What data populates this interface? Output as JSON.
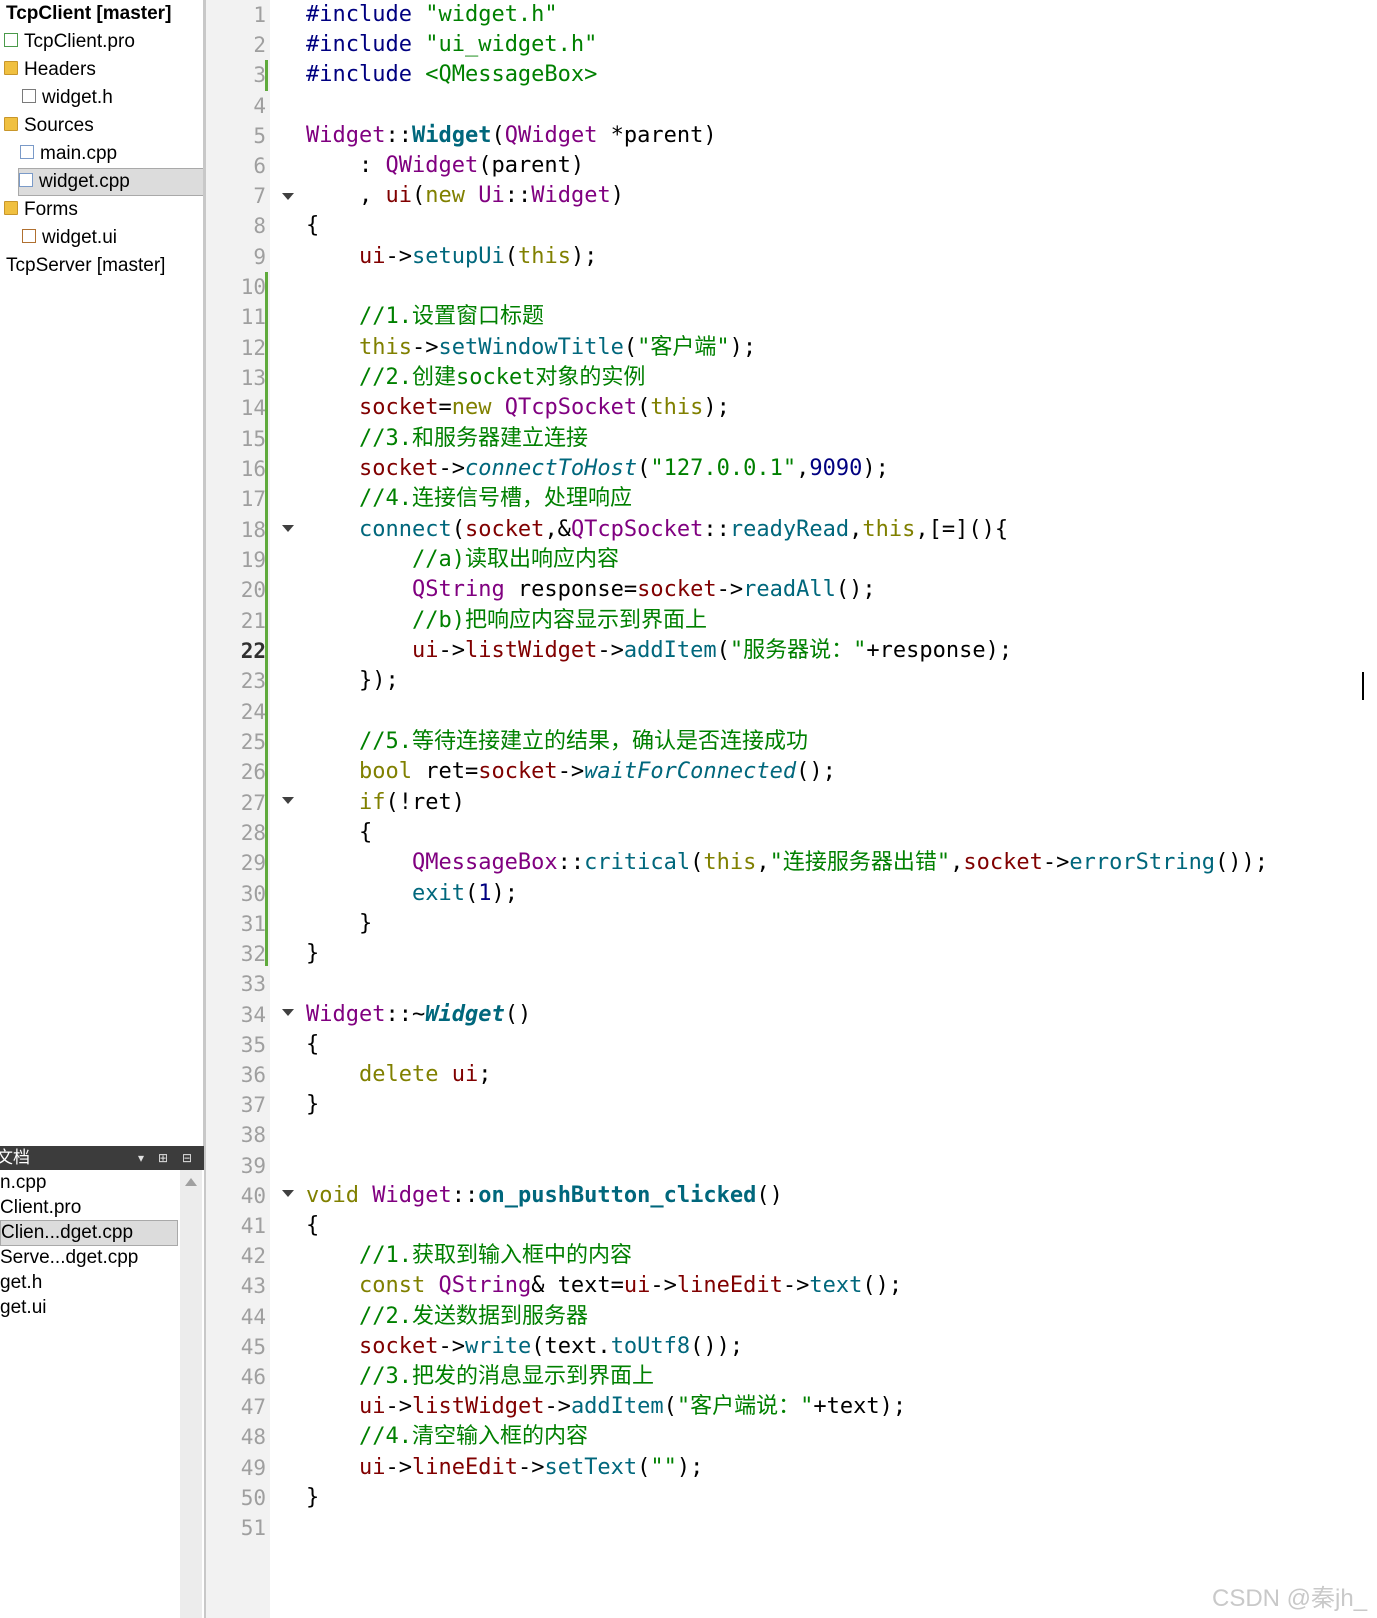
{
  "project_tree": {
    "items": [
      {
        "label": "TcpClient [master]",
        "icon": "none",
        "bold": true
      },
      {
        "label": "TcpClient.pro",
        "icon": "pro-file-icon"
      },
      {
        "label": "Headers",
        "icon": "folder-icon"
      },
      {
        "label": "widget.h",
        "icon": "header-file-icon"
      },
      {
        "label": "Sources",
        "icon": "folder-icon"
      },
      {
        "label": "main.cpp",
        "icon": "cpp-file-icon"
      },
      {
        "label": "widget.cpp",
        "icon": "cpp-file-icon",
        "selected": true
      },
      {
        "label": "Forms",
        "icon": "folder-icon"
      },
      {
        "label": "widget.ui",
        "icon": "ui-file-icon"
      },
      {
        "label": "TcpServer [master]",
        "icon": "none"
      }
    ]
  },
  "open_documents": {
    "title": "文档",
    "items": [
      {
        "label": "n.cpp"
      },
      {
        "label": "Client.pro"
      },
      {
        "label": "Clien...dget.cpp",
        "selected": true
      },
      {
        "label": "Serve...dget.cpp"
      },
      {
        "label": "get.h"
      },
      {
        "label": "get.ui"
      }
    ]
  },
  "editor": {
    "current_line": "22",
    "lines": [
      {
        "n": "1",
        "t": [
          [
            "pp",
            "#include "
          ],
          [
            "str",
            "\"widget.h\""
          ]
        ]
      },
      {
        "n": "2",
        "t": [
          [
            "pp",
            "#include "
          ],
          [
            "str",
            "\"ui_widget.h\""
          ]
        ]
      },
      {
        "n": "3",
        "t": [
          [
            "pp",
            "#include "
          ],
          [
            "str",
            "<QMessageBox>"
          ]
        ]
      },
      {
        "n": "4",
        "t": []
      },
      {
        "n": "5",
        "t": [
          [
            "cls",
            "Widget"
          ],
          [
            "plain",
            "::"
          ],
          [
            "fnb",
            "Widget"
          ],
          [
            "plain",
            "("
          ],
          [
            "cls",
            "QWidget"
          ],
          [
            "plain",
            " *parent)"
          ]
        ]
      },
      {
        "n": "6",
        "t": [
          [
            "plain",
            "    : "
          ],
          [
            "cls",
            "QWidget"
          ],
          [
            "plain",
            "(parent)"
          ]
        ]
      },
      {
        "n": "7",
        "t": [
          [
            "plain",
            "    , "
          ],
          [
            "mem",
            "ui"
          ],
          [
            "plain",
            "("
          ],
          [
            "kw",
            "new"
          ],
          [
            "plain",
            " "
          ],
          [
            "cls",
            "Ui"
          ],
          [
            "plain",
            "::"
          ],
          [
            "cls",
            "Widget"
          ],
          [
            "plain",
            ")"
          ]
        ]
      },
      {
        "n": "8",
        "t": [
          [
            "plain",
            "{"
          ]
        ]
      },
      {
        "n": "9",
        "t": [
          [
            "plain",
            "    "
          ],
          [
            "mem",
            "ui"
          ],
          [
            "plain",
            "->"
          ],
          [
            "fn",
            "setupUi"
          ],
          [
            "plain",
            "("
          ],
          [
            "kw",
            "this"
          ],
          [
            "plain",
            ");"
          ]
        ]
      },
      {
        "n": "10",
        "t": []
      },
      {
        "n": "11",
        "t": [
          [
            "cm",
            "    //1.设置窗口标题"
          ]
        ]
      },
      {
        "n": "12",
        "t": [
          [
            "plain",
            "    "
          ],
          [
            "kw",
            "this"
          ],
          [
            "plain",
            "->"
          ],
          [
            "fn",
            "setWindowTitle"
          ],
          [
            "plain",
            "("
          ],
          [
            "str",
            "\"客户端\""
          ],
          [
            "plain",
            ");"
          ]
        ]
      },
      {
        "n": "13",
        "t": [
          [
            "cm",
            "    //2.创建socket对象的实例"
          ]
        ]
      },
      {
        "n": "14",
        "t": [
          [
            "plain",
            "    "
          ],
          [
            "mem",
            "socket"
          ],
          [
            "plain",
            "="
          ],
          [
            "kw",
            "new"
          ],
          [
            "plain",
            " "
          ],
          [
            "cls",
            "QTcpSocket"
          ],
          [
            "plain",
            "("
          ],
          [
            "kw",
            "this"
          ],
          [
            "plain",
            ");"
          ]
        ]
      },
      {
        "n": "15",
        "t": [
          [
            "cm",
            "    //3.和服务器建立连接"
          ]
        ]
      },
      {
        "n": "16",
        "t": [
          [
            "plain",
            "    "
          ],
          [
            "mem",
            "socket"
          ],
          [
            "plain",
            "->"
          ],
          [
            "fni",
            "connectToHost"
          ],
          [
            "plain",
            "("
          ],
          [
            "str",
            "\"127.0.0.1\""
          ],
          [
            "plain",
            ","
          ],
          [
            "num",
            "9090"
          ],
          [
            "plain",
            ");"
          ]
        ]
      },
      {
        "n": "17",
        "t": [
          [
            "cm",
            "    //4.连接信号槽，处理响应"
          ]
        ]
      },
      {
        "n": "18",
        "t": [
          [
            "plain",
            "    "
          ],
          [
            "fn",
            "connect"
          ],
          [
            "plain",
            "("
          ],
          [
            "mem",
            "socket"
          ],
          [
            "plain",
            ",&"
          ],
          [
            "cls",
            "QTcpSocket"
          ],
          [
            "plain",
            "::"
          ],
          [
            "fn",
            "readyRead"
          ],
          [
            "plain",
            ","
          ],
          [
            "kw",
            "this"
          ],
          [
            "plain",
            ",[=](){"
          ]
        ]
      },
      {
        "n": "19",
        "t": [
          [
            "cm",
            "        //a)读取出响应内容"
          ]
        ]
      },
      {
        "n": "20",
        "t": [
          [
            "plain",
            "        "
          ],
          [
            "cls",
            "QString"
          ],
          [
            "plain",
            " response="
          ],
          [
            "mem",
            "socket"
          ],
          [
            "plain",
            "->"
          ],
          [
            "fn",
            "readAll"
          ],
          [
            "plain",
            "();"
          ]
        ]
      },
      {
        "n": "21",
        "t": [
          [
            "cm",
            "        //b)把响应内容显示到界面上"
          ]
        ]
      },
      {
        "n": "22",
        "t": [
          [
            "plain",
            "        "
          ],
          [
            "mem",
            "ui"
          ],
          [
            "plain",
            "->"
          ],
          [
            "mem",
            "listWidget"
          ],
          [
            "plain",
            "->"
          ],
          [
            "fn",
            "addItem"
          ],
          [
            "plain",
            "("
          ],
          [
            "str",
            "\"服务器说：\""
          ],
          [
            "plain",
            "+response);"
          ]
        ]
      },
      {
        "n": "23",
        "t": [
          [
            "plain",
            "    });"
          ]
        ]
      },
      {
        "n": "24",
        "t": []
      },
      {
        "n": "25",
        "t": [
          [
            "cm",
            "    //5.等待连接建立的结果，确认是否连接成功"
          ]
        ]
      },
      {
        "n": "26",
        "t": [
          [
            "plain",
            "    "
          ],
          [
            "kw",
            "bool"
          ],
          [
            "plain",
            " ret="
          ],
          [
            "mem",
            "socket"
          ],
          [
            "plain",
            "->"
          ],
          [
            "fni",
            "waitForConnected"
          ],
          [
            "plain",
            "();"
          ]
        ]
      },
      {
        "n": "27",
        "t": [
          [
            "plain",
            "    "
          ],
          [
            "kw",
            "if"
          ],
          [
            "plain",
            "(!ret)"
          ]
        ]
      },
      {
        "n": "28",
        "t": [
          [
            "plain",
            "    {"
          ]
        ]
      },
      {
        "n": "29",
        "t": [
          [
            "plain",
            "        "
          ],
          [
            "cls",
            "QMessageBox"
          ],
          [
            "plain",
            "::"
          ],
          [
            "fn",
            "critical"
          ],
          [
            "plain",
            "("
          ],
          [
            "kw",
            "this"
          ],
          [
            "plain",
            ","
          ],
          [
            "str",
            "\"连接服务器出错\""
          ],
          [
            "plain",
            ","
          ],
          [
            "mem",
            "socket"
          ],
          [
            "plain",
            "->"
          ],
          [
            "fn",
            "errorString"
          ],
          [
            "plain",
            "());"
          ]
        ]
      },
      {
        "n": "30",
        "t": [
          [
            "plain",
            "        "
          ],
          [
            "fn",
            "exit"
          ],
          [
            "plain",
            "("
          ],
          [
            "num",
            "1"
          ],
          [
            "plain",
            ");"
          ]
        ]
      },
      {
        "n": "31",
        "t": [
          [
            "plain",
            "    }"
          ]
        ]
      },
      {
        "n": "32",
        "t": [
          [
            "plain",
            "}"
          ]
        ]
      },
      {
        "n": "33",
        "t": []
      },
      {
        "n": "34",
        "t": [
          [
            "cls",
            "Widget"
          ],
          [
            "plain",
            "::~"
          ],
          [
            "fnbi",
            "Widget"
          ],
          [
            "plain",
            "()"
          ]
        ]
      },
      {
        "n": "35",
        "t": [
          [
            "plain",
            "{"
          ]
        ]
      },
      {
        "n": "36",
        "t": [
          [
            "plain",
            "    "
          ],
          [
            "kw",
            "delete"
          ],
          [
            "plain",
            " "
          ],
          [
            "mem",
            "ui"
          ],
          [
            "plain",
            ";"
          ]
        ]
      },
      {
        "n": "37",
        "t": [
          [
            "plain",
            "}"
          ]
        ]
      },
      {
        "n": "38",
        "t": []
      },
      {
        "n": "39",
        "t": []
      },
      {
        "n": "40",
        "t": [
          [
            "kw",
            "void"
          ],
          [
            "plain",
            " "
          ],
          [
            "cls",
            "Widget"
          ],
          [
            "plain",
            "::"
          ],
          [
            "fnb",
            "on_pushButton_clicked"
          ],
          [
            "plain",
            "()"
          ]
        ]
      },
      {
        "n": "41",
        "t": [
          [
            "plain",
            "{"
          ]
        ]
      },
      {
        "n": "42",
        "t": [
          [
            "cm",
            "    //1.获取到输入框中的内容"
          ]
        ]
      },
      {
        "n": "43",
        "t": [
          [
            "plain",
            "    "
          ],
          [
            "kw",
            "const"
          ],
          [
            "plain",
            " "
          ],
          [
            "cls",
            "QString"
          ],
          [
            "plain",
            "& text="
          ],
          [
            "mem",
            "ui"
          ],
          [
            "plain",
            "->"
          ],
          [
            "mem",
            "lineEdit"
          ],
          [
            "plain",
            "->"
          ],
          [
            "fn",
            "text"
          ],
          [
            "plain",
            "();"
          ]
        ]
      },
      {
        "n": "44",
        "t": [
          [
            "cm",
            "    //2.发送数据到服务器"
          ]
        ]
      },
      {
        "n": "45",
        "t": [
          [
            "plain",
            "    "
          ],
          [
            "mem",
            "socket"
          ],
          [
            "plain",
            "->"
          ],
          [
            "fn",
            "write"
          ],
          [
            "plain",
            "(text."
          ],
          [
            "fn",
            "toUtf8"
          ],
          [
            "plain",
            "());"
          ]
        ]
      },
      {
        "n": "46",
        "t": [
          [
            "cm",
            "    //3.把发的消息显示到界面上"
          ]
        ]
      },
      {
        "n": "47",
        "t": [
          [
            "plain",
            "    "
          ],
          [
            "mem",
            "ui"
          ],
          [
            "plain",
            "->"
          ],
          [
            "mem",
            "listWidget"
          ],
          [
            "plain",
            "->"
          ],
          [
            "fn",
            "addItem"
          ],
          [
            "plain",
            "("
          ],
          [
            "str",
            "\"客户端说：\""
          ],
          [
            "plain",
            "+text);"
          ]
        ]
      },
      {
        "n": "48",
        "t": [
          [
            "cm",
            "    //4.清空输入框的内容"
          ]
        ]
      },
      {
        "n": "49",
        "t": [
          [
            "plain",
            "    "
          ],
          [
            "mem",
            "ui"
          ],
          [
            "plain",
            "->"
          ],
          [
            "mem",
            "lineEdit"
          ],
          [
            "plain",
            "->"
          ],
          [
            "fn",
            "setText"
          ],
          [
            "plain",
            "("
          ],
          [
            "str",
            "\"\""
          ],
          [
            "plain",
            ");"
          ]
        ]
      },
      {
        "n": "50",
        "t": [
          [
            "plain",
            "}"
          ]
        ]
      },
      {
        "n": "51",
        "t": []
      }
    ]
  },
  "watermark": "CSDN @秦jh_"
}
